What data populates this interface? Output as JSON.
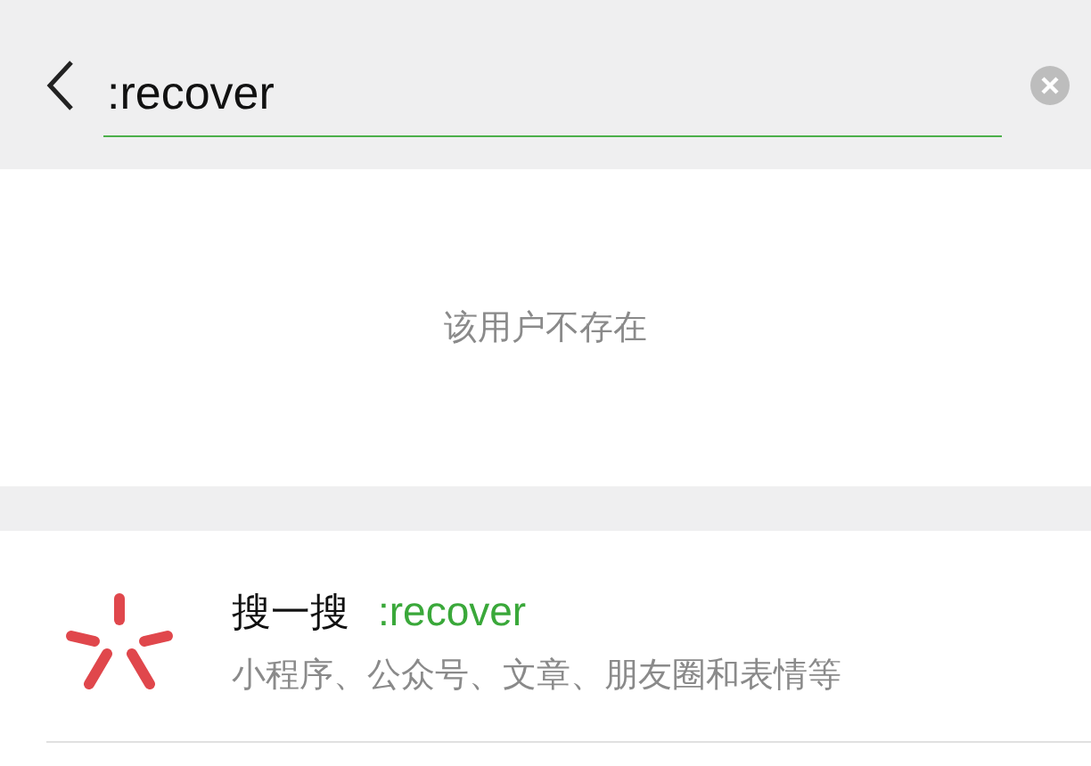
{
  "search": {
    "value": ":recover"
  },
  "message": "该用户不存在",
  "result": {
    "title": "搜一搜",
    "keyword": ":recover",
    "subtitle": "小程序、公众号、文章、朋友圈和表情等"
  }
}
